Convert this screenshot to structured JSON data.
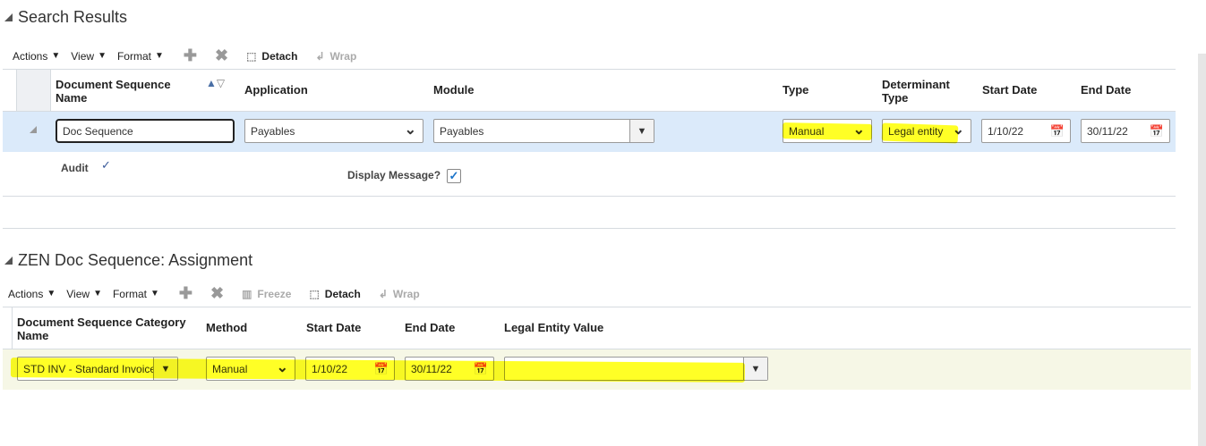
{
  "search": {
    "title": "Search Results",
    "toolbar": {
      "actions": "Actions",
      "view": "View",
      "format": "Format",
      "detach": "Detach",
      "wrap": "Wrap"
    },
    "columns": [
      "Document Sequence Name",
      "Application",
      "Module",
      "Type",
      "Determinant Type",
      "Start Date",
      "End Date"
    ],
    "row": {
      "name": "Doc Sequence",
      "application": "Payables",
      "module": "Payables",
      "type": "Manual",
      "determinant_type": "Legal entity",
      "start_date": "1/10/22",
      "end_date": "30/11/22"
    },
    "detail": {
      "audit_label": "Audit",
      "audit_mark": "✓",
      "display_message_label": "Display Message?",
      "display_message_checked": true
    }
  },
  "assignment": {
    "title": "ZEN Doc Sequence: Assignment",
    "toolbar": {
      "actions": "Actions",
      "view": "View",
      "format": "Format",
      "freeze": "Freeze",
      "detach": "Detach",
      "wrap": "Wrap"
    },
    "columns": [
      "Document Sequence Category Name",
      "Method",
      "Start Date",
      "End Date",
      "Legal Entity Value"
    ],
    "row": {
      "category": "STD INV - Standard Invoice",
      "method": "Manual",
      "start_date": "1/10/22",
      "end_date": "30/11/22",
      "legal_entity": ""
    }
  },
  "colors": {
    "row_selected": "#dbeafa",
    "row_assignment": "#f6f7e6",
    "highlight": "#ffff00"
  }
}
